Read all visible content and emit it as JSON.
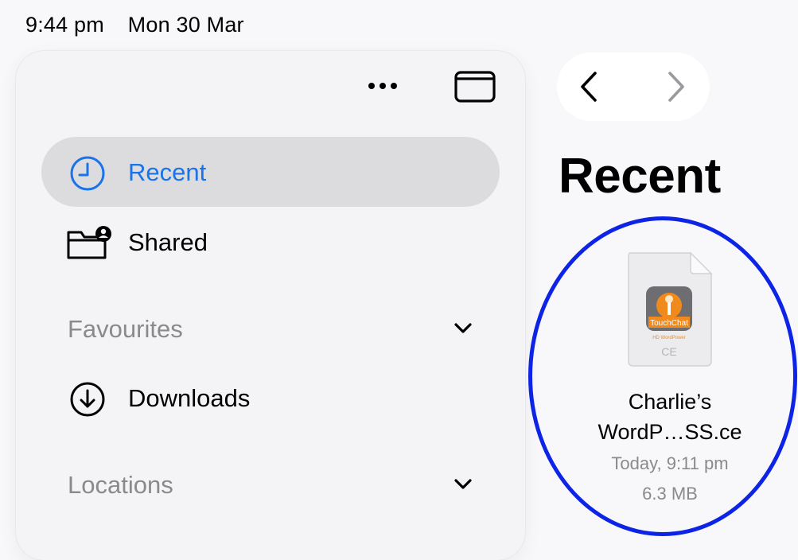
{
  "status_bar": {
    "time": "9:44 pm",
    "date": "Mon 30 Mar"
  },
  "sidebar": {
    "toolbar": {
      "more_icon": "ellipsis-icon",
      "toggle_icon": "sidebar-toggle-icon"
    },
    "items": [
      {
        "label": "Recent",
        "icon": "clock-icon",
        "selected": true
      },
      {
        "label": "Shared",
        "icon": "shared-folder-icon",
        "selected": false
      }
    ],
    "sections": [
      {
        "label": "Favourites",
        "expanded": false,
        "items": [
          {
            "label": "Downloads",
            "icon": "download-circle-icon"
          }
        ]
      },
      {
        "label": "Locations",
        "expanded": false,
        "items": []
      }
    ]
  },
  "nav": {
    "back_icon": "chevron-left-icon",
    "forward_icon": "chevron-right-icon",
    "forward_enabled": false
  },
  "main": {
    "title": "Recent",
    "files": [
      {
        "name_line1": "Charlie’s",
        "name_line2": "WordP…SS.ce",
        "modified": "Today, 9:11 pm",
        "size": "6.3 MB",
        "type_label": "CE",
        "thumbnail_brand": "TouchChat",
        "thumbnail_sub": "HD WordPower"
      }
    ]
  },
  "colors": {
    "accent": "#1a73e8",
    "highlight_ring": "#0d24e6",
    "thumbnail_orange": "#f08a1c"
  }
}
